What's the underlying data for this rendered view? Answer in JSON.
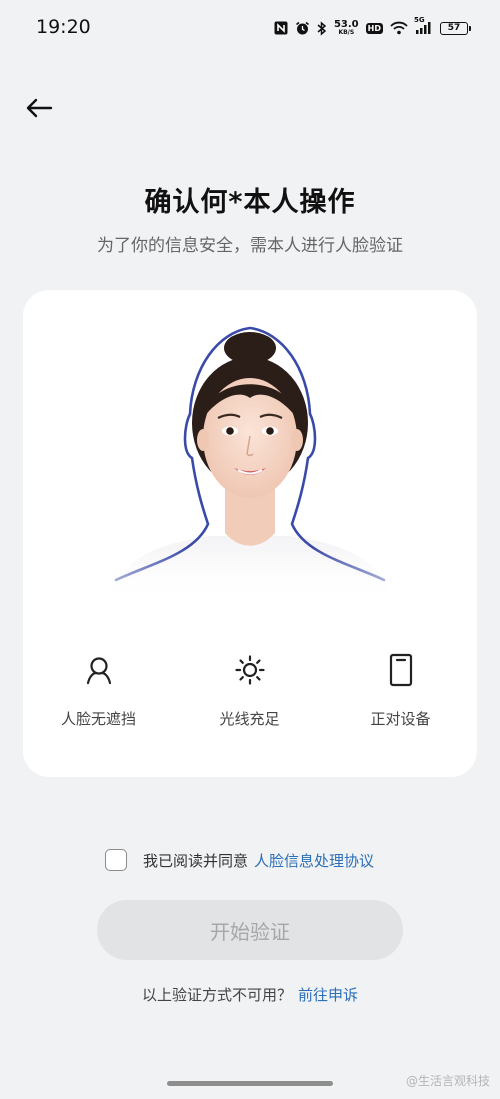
{
  "status_bar": {
    "time": "19:20",
    "net_speed_value": "53.0",
    "net_speed_unit": "KB/S",
    "hd_badge": "HD",
    "signal_label": "5G",
    "battery": "57",
    "icons": [
      "nfc-icon",
      "alarm-icon",
      "bluetooth-icon",
      "wifi-icon",
      "signal-icon",
      "battery-icon"
    ]
  },
  "header": {
    "back_icon": "arrow-left-icon",
    "title": "确认何*本人操作",
    "subtitle": "为了你的信息安全，需本人进行人脸验证"
  },
  "card": {
    "tips": [
      {
        "label": "人脸无遮挡",
        "icon": "person-outline-icon"
      },
      {
        "label": "光线充足",
        "icon": "sun-icon"
      },
      {
        "label": "正对设备",
        "icon": "phone-icon"
      }
    ]
  },
  "agreement": {
    "checked": false,
    "text": "我已阅读并同意",
    "link": "人脸信息处理协议"
  },
  "start_button": {
    "label": "开始验证",
    "enabled": false
  },
  "alternate": {
    "text": "以上验证方式不可用？",
    "link": "前往申诉"
  },
  "watermark": "@生活言观科技",
  "colors": {
    "background": "#f1f2f4",
    "card": "#ffffff",
    "link": "#2a6fb7",
    "button_disabled_bg": "#e2e3e5",
    "button_disabled_text": "#a6a7a9",
    "face_outline": "#3a4aa8"
  }
}
